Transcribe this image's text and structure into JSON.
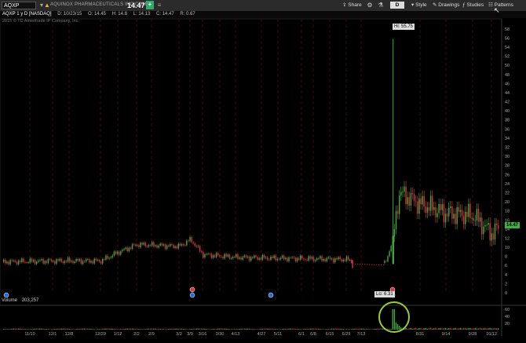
{
  "toolbar": {
    "symbol": "AQXP",
    "company": "AQUINOX PHARMACEUTICALS INC COM",
    "price": "14.47",
    "buttons": {
      "share": "Share",
      "period": "D",
      "style": "Style",
      "drawings": "Drawings",
      "studies": "Studies",
      "patterns": "Patterns"
    }
  },
  "infobar": {
    "title": "AQXP 1 y D [NASDAQ]",
    "date": "D: 10/23/15",
    "open": "O: 14.45",
    "high": "H: 14.8",
    "low": "L: 14.13",
    "close": "C: 14.47",
    "range": "R: 0.67"
  },
  "copyright": "2015 © TD Ameritrade IP Company, Inc.",
  "labels": {
    "hi": "Hi: 55.75",
    "lo": "Lo: 6.31",
    "current_price": "14.47"
  },
  "volume": {
    "label": "Volume",
    "value": "203,257"
  },
  "colors": {
    "up": "#3fb040",
    "down": "#e0303a",
    "grid": "#4a1010",
    "axis_text": "#aaaaaa"
  },
  "chart_data": {
    "type": "candlestick",
    "title": "AQXP 1 y D [NASDAQ]",
    "y_axis": {
      "ticks": [
        58,
        56,
        54,
        52,
        50,
        48,
        46,
        44,
        42,
        40,
        38,
        36,
        34,
        32,
        30,
        28,
        26,
        24,
        22,
        20,
        18,
        16,
        14,
        12,
        10,
        8,
        6,
        4,
        2,
        0
      ],
      "range": [
        0,
        59
      ]
    },
    "x_axis": {
      "ticks": [
        "11/10",
        "12/1",
        "12/8",
        "12/29",
        "1/12",
        "2/2",
        "2/9",
        "3/2",
        "3/9",
        "3/16",
        "3/30",
        "4/13",
        "4/27",
        "5/11",
        "6/1",
        "6/8",
        "6/15",
        "6/29",
        "7/13",
        "8/31",
        "9/14",
        "9/28",
        "10/12"
      ]
    },
    "volume_axis": {
      "ticks": [
        60,
        40,
        20
      ],
      "unit": "millions"
    },
    "close_path": [
      {
        "date": "10/31",
        "close": 6.8
      },
      {
        "date": "12/1",
        "close": 7.0
      },
      {
        "date": "12/29",
        "close": 7.0
      },
      {
        "date": "1/12",
        "close": 8.9
      },
      {
        "date": "2/2",
        "close": 10.6
      },
      {
        "date": "3/2",
        "close": 10.2
      },
      {
        "date": "3/9",
        "close": 11.7
      },
      {
        "date": "3/16",
        "close": 8.4
      },
      {
        "date": "4/13",
        "close": 7.8
      },
      {
        "date": "5/11",
        "close": 7.6
      },
      {
        "date": "6/15",
        "close": 7.4
      },
      {
        "date": "6/29",
        "close": 7.3
      },
      {
        "date": "7/13",
        "close": 6.4
      },
      {
        "date": "8/3",
        "close": 6.3
      },
      {
        "date": "8/10",
        "close": 12.0
      },
      {
        "date": "8/17",
        "close": 22.0
      },
      {
        "date": "8/31",
        "close": 19.5
      },
      {
        "date": "9/14",
        "close": 17.5
      },
      {
        "date": "9/28",
        "close": 17.0
      },
      {
        "date": "10/12",
        "close": 13.0
      },
      {
        "date": "10/23",
        "close": 14.47
      }
    ],
    "spike": {
      "date": "8/10",
      "high": 55.75,
      "low": 6.31
    }
  }
}
